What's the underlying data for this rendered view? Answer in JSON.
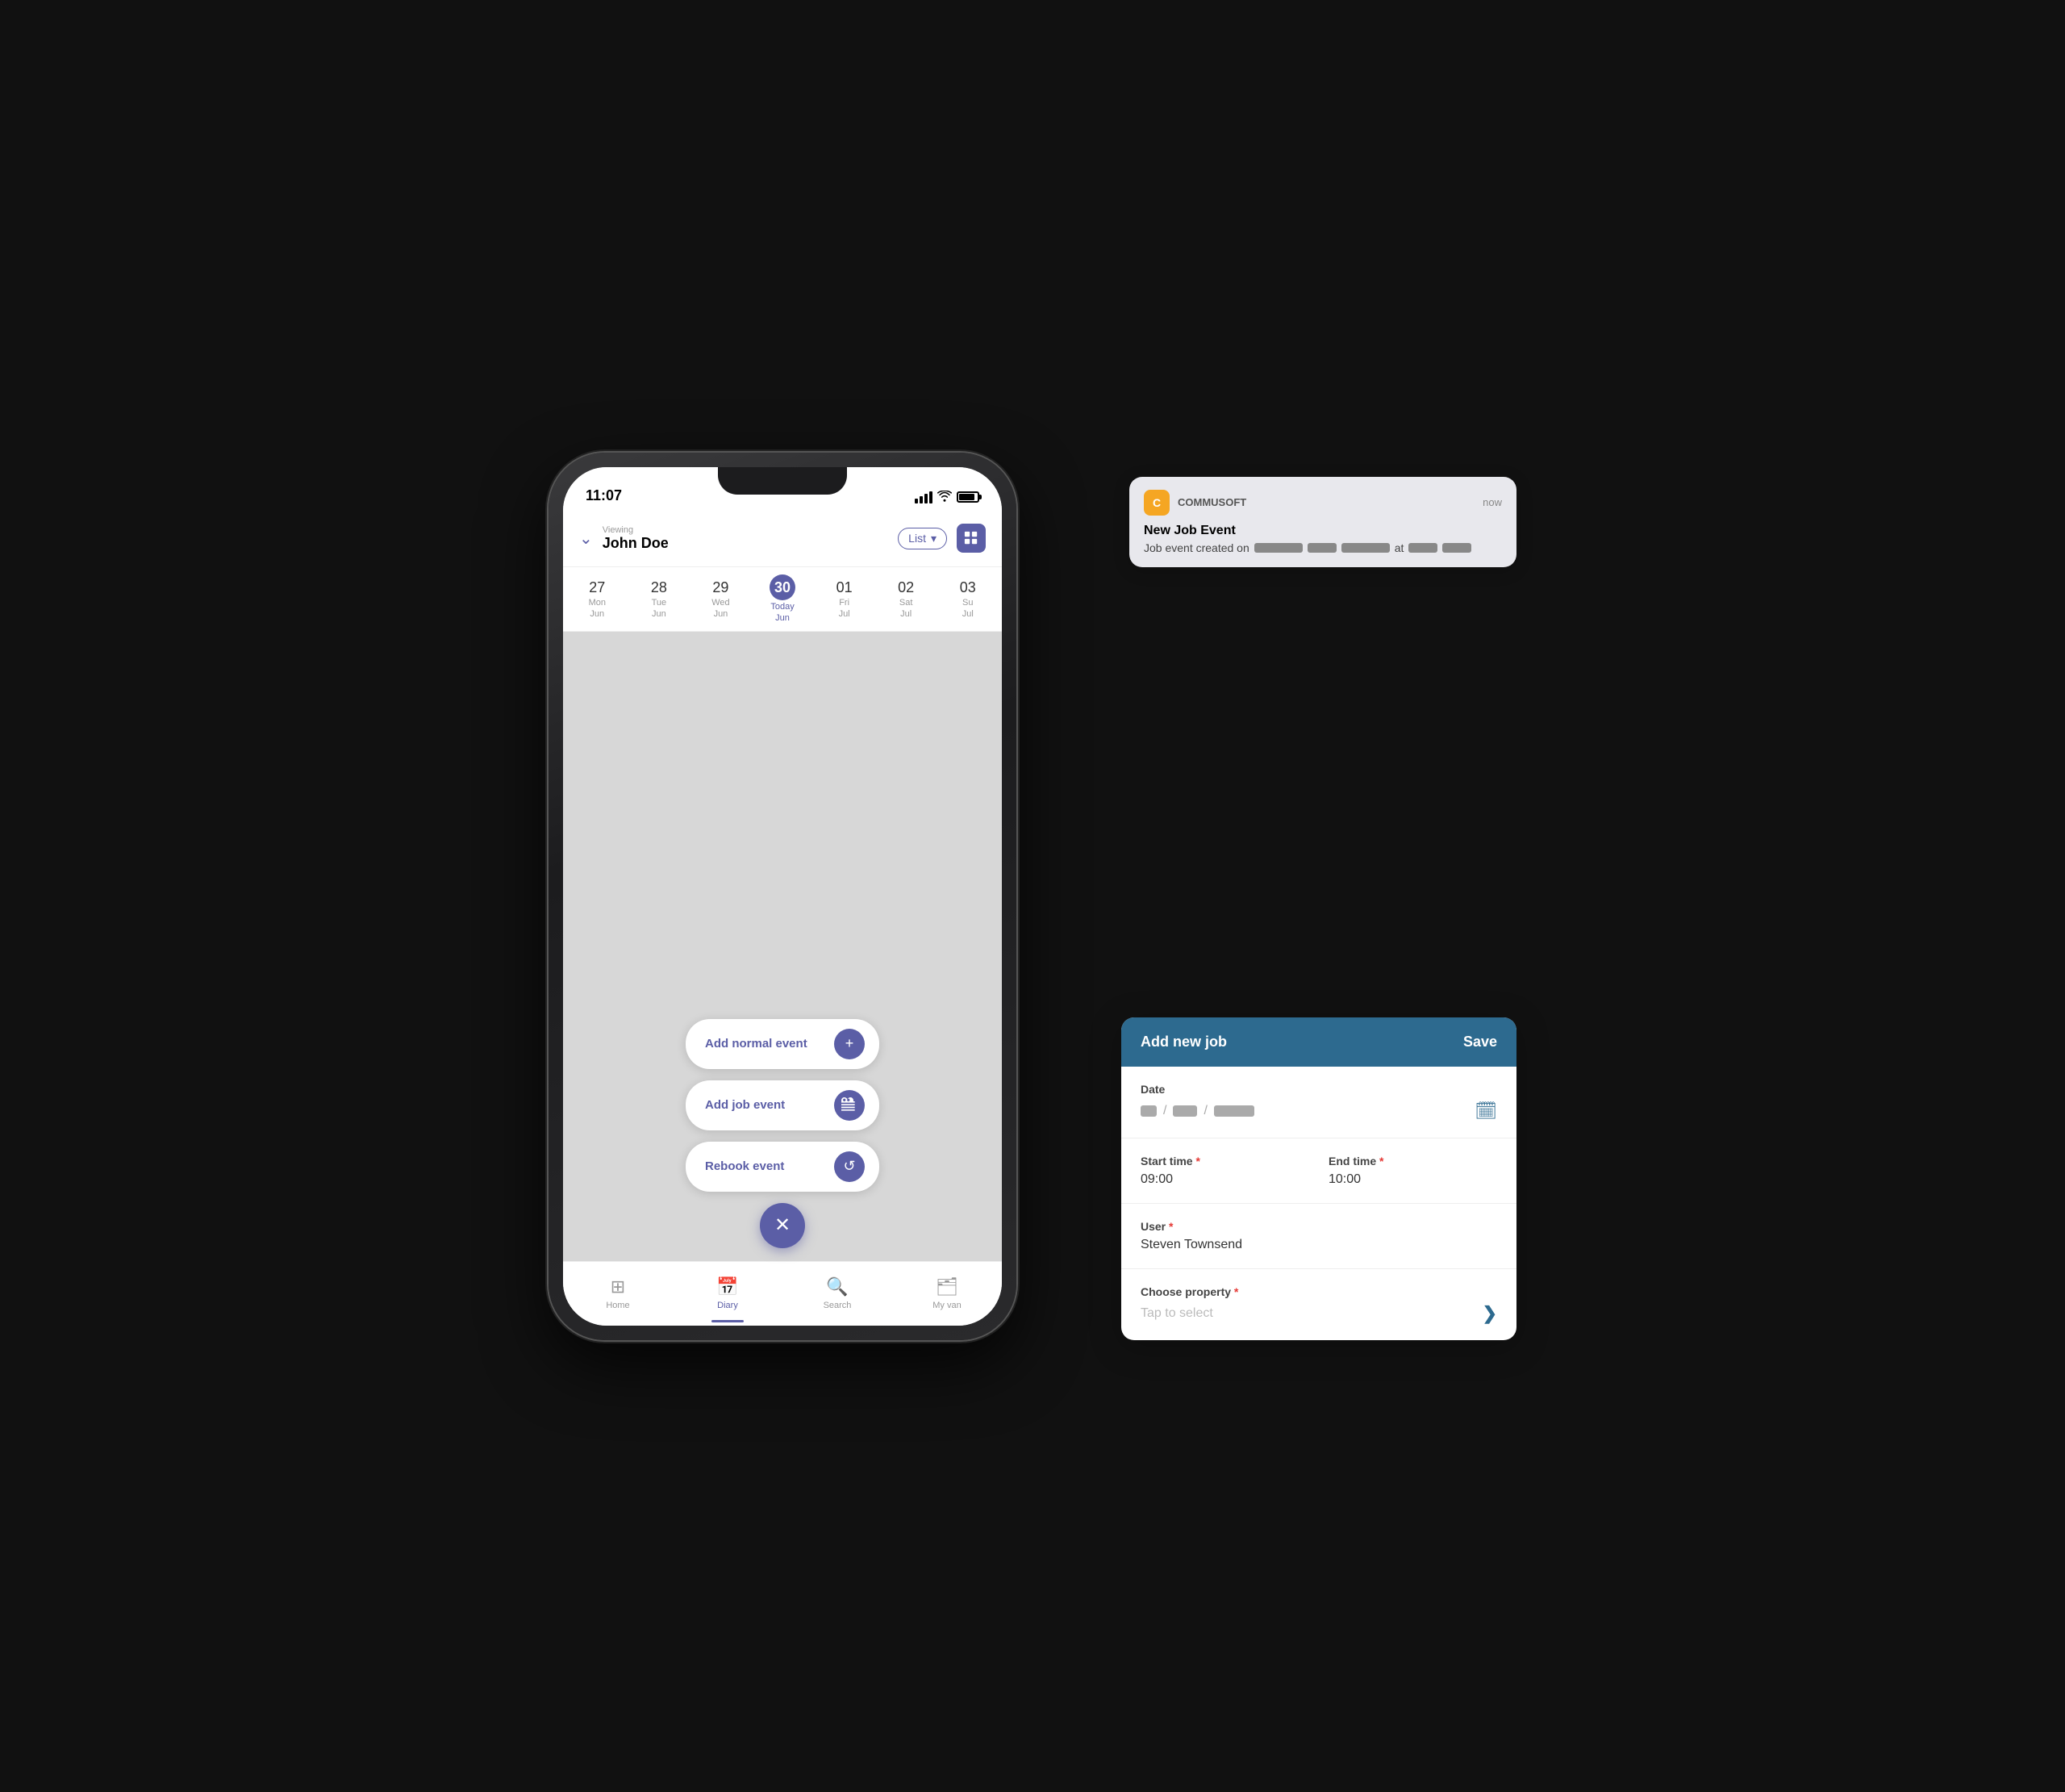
{
  "scene": {
    "background": "#111"
  },
  "phone": {
    "status": {
      "time": "11:07"
    },
    "header": {
      "viewing_label": "Viewing",
      "user_name": "John Doe",
      "list_button": "List",
      "dropdown_icon": "▾"
    },
    "calendar": {
      "days": [
        {
          "num": "27",
          "name": "Mon",
          "month": "Jun",
          "today": false
        },
        {
          "num": "28",
          "name": "Tue",
          "month": "Jun",
          "today": false
        },
        {
          "num": "29",
          "name": "Wed",
          "month": "Jun",
          "today": false
        },
        {
          "num": "30",
          "name": "Today",
          "month": "Jun",
          "today": true
        },
        {
          "num": "01",
          "name": "Fri",
          "month": "Jul",
          "today": false
        },
        {
          "num": "02",
          "name": "Sat",
          "month": "Jul",
          "today": false
        },
        {
          "num": "03",
          "name": "Su",
          "month": "Jul",
          "today": false
        }
      ]
    },
    "fab_buttons": [
      {
        "id": "add-normal-event",
        "label": "Add normal event",
        "icon": "+"
      },
      {
        "id": "add-job-event",
        "label": "Add job event",
        "icon": "💼"
      },
      {
        "id": "rebook-event",
        "label": "Rebook event",
        "icon": "🔄"
      }
    ],
    "fab_close_icon": "✕",
    "nav": {
      "items": [
        {
          "id": "home",
          "label": "Home",
          "icon": "⊞",
          "active": false
        },
        {
          "id": "diary",
          "label": "Diary",
          "icon": "📅",
          "active": true
        },
        {
          "id": "search",
          "label": "Search",
          "icon": "🔍",
          "active": false
        },
        {
          "id": "my-van",
          "label": "My van",
          "icon": "🗂",
          "active": false
        }
      ]
    }
  },
  "notification": {
    "app_icon_letter": "C",
    "app_name": "COMMUSOFT",
    "time": "now",
    "title": "New Job Event",
    "body_prefix": "Job event created on",
    "body_suffix": "at"
  },
  "add_job_panel": {
    "header": {
      "title": "Add new job",
      "save_label": "Save"
    },
    "date_label": "Date",
    "calendar_icon": "🗓",
    "start_time_label": "Start time",
    "start_time_required": "*",
    "start_time_value": "09:00",
    "end_time_label": "End time",
    "end_time_required": "*",
    "end_time_value": "10:00",
    "user_label": "User",
    "user_required": "*",
    "user_value": "Steven Townsend",
    "choose_property_label": "Choose property",
    "choose_property_required": "*",
    "choose_property_placeholder": "Tap to select",
    "chevron_icon": "❯"
  }
}
